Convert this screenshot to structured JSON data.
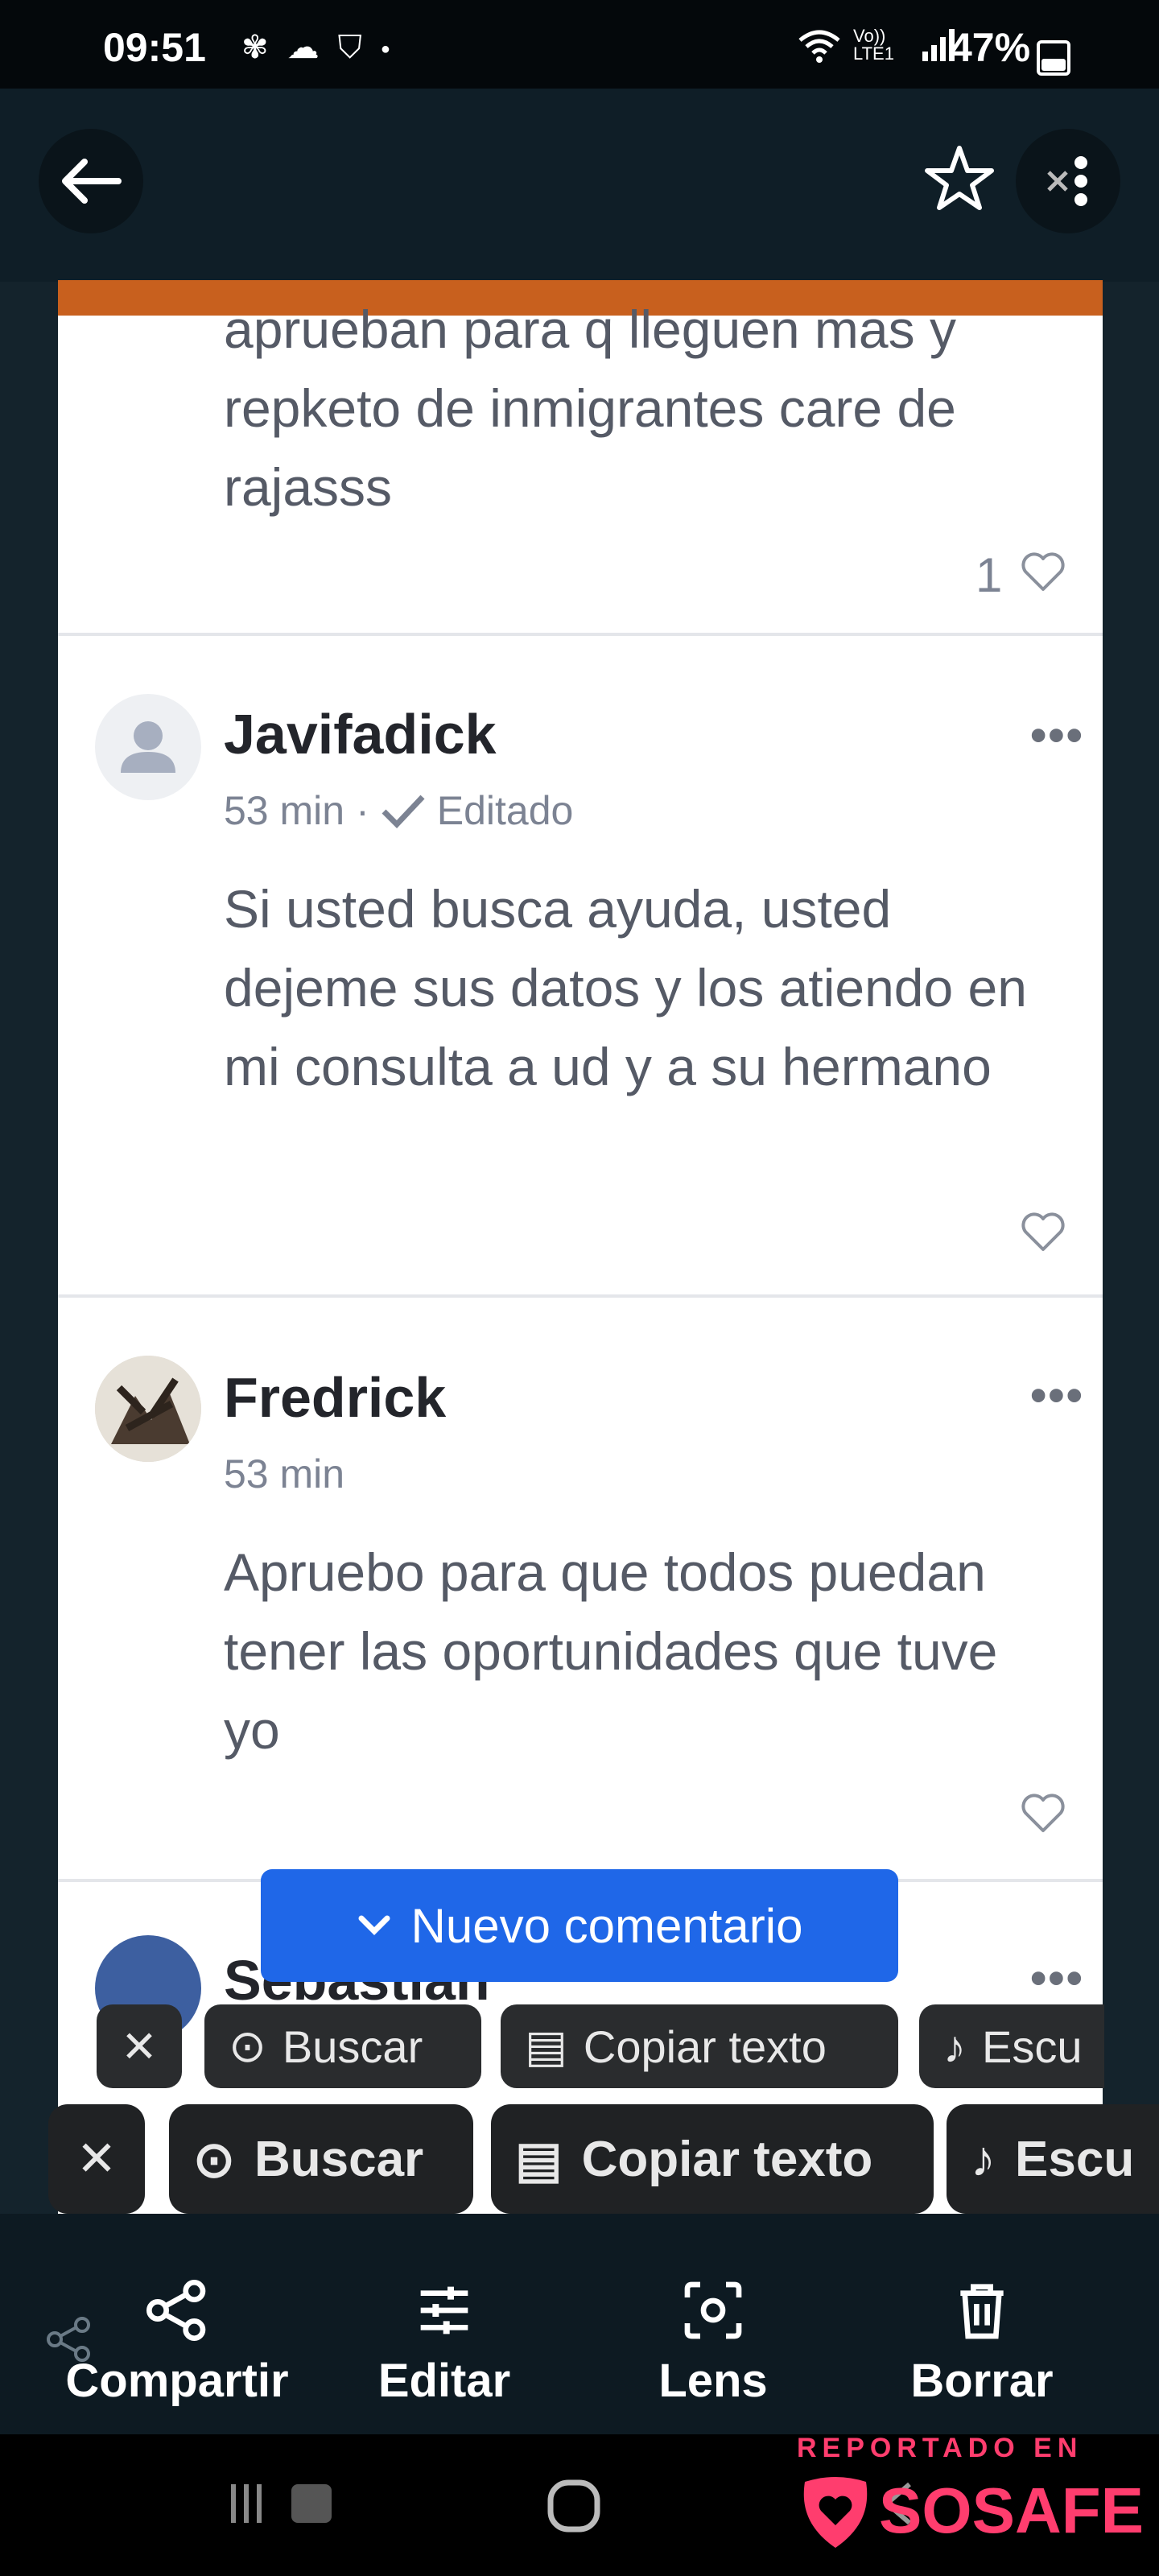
{
  "status_bar": {
    "time": "09:51",
    "network": "Vo)) LTE1",
    "battery_percent": "47%",
    "battery_level": 0.47
  },
  "comments": [
    {
      "text": "aprueban para q lleguen mas y repketo de inmigrantes care de rajasss",
      "likes": "1"
    },
    {
      "author": "Javifadick",
      "time": "53 min",
      "edited": "Editado",
      "text": "Si usted busca ayuda, usted dejeme sus datos y los atiendo en mi consulta a ud y a su hermano"
    },
    {
      "author": "Fredrick",
      "time": "53 min",
      "text": "Apruebo para que todos puedan tener las oportunidades que tuve yo"
    },
    {
      "author": "Sebastian"
    }
  ],
  "new_comment_label": "Nuevo comentario",
  "lens_chips": {
    "search": "Buscar",
    "copy_text": "Copiar texto",
    "listen": "Escu"
  },
  "bottom_actions": {
    "share": "Compartir",
    "edit": "Editar",
    "lens": "Lens",
    "delete": "Borrar"
  },
  "watermark": {
    "line1": "REPORTADO EN",
    "brand": "SOSAFE"
  },
  "colors": {
    "accent_blue": "#1f67e8",
    "brand_pink": "#ff3d6e",
    "top_strip": "#c8601e"
  }
}
